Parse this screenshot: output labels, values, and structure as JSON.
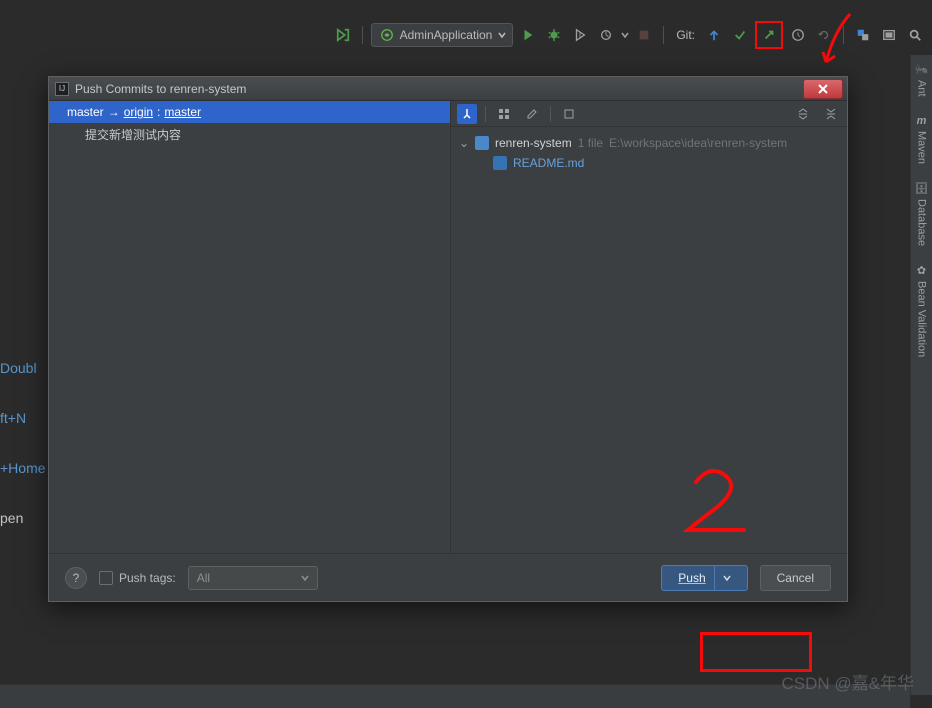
{
  "toolbar": {
    "run_config": "AdminApplication",
    "git_label": "Git:"
  },
  "sidebar_right": {
    "ant": "Ant",
    "maven": "Maven",
    "database": "Database",
    "bean": "Bean Validation"
  },
  "left_links": {
    "l1": "Doubl",
    "l2": "ft+N",
    "l3": "+Home",
    "l4": "pen"
  },
  "dialog": {
    "title": "Push Commits to renren-system",
    "branch_local": "master",
    "branch_arrow": "→",
    "branch_remote": "origin",
    "branch_colon": " : ",
    "branch_remote_ref": "master",
    "commit_msg": "提交新增测试内容",
    "tree_project": "renren-system",
    "tree_count": "1 file",
    "tree_path": "E:\\workspace\\idea\\renren-system",
    "tree_file": "README.md",
    "push_tags_label": "Push tags:",
    "combo_value": "All",
    "push_button": "Push",
    "cancel_button": "Cancel"
  },
  "annotation": {
    "two": "2"
  },
  "watermark": "CSDN @嘉&年华"
}
